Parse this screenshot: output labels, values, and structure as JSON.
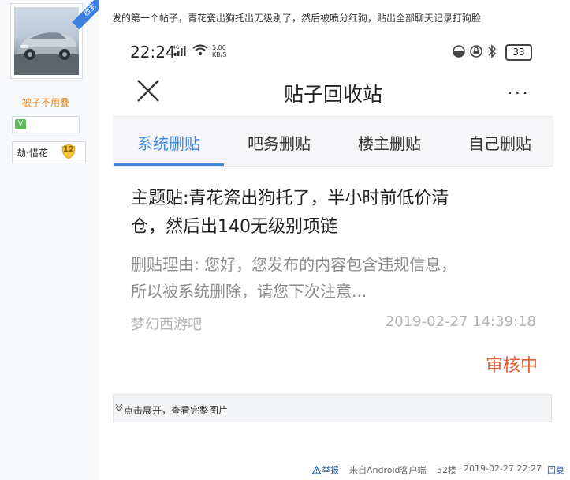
{
  "author": {
    "ribbon": "楼主",
    "username": "被子不用叠",
    "level_icon": "V",
    "fan_title": "劫·惜花",
    "fan_level": "12"
  },
  "post": {
    "text": "发的第一个帖子，青花瓷出狗托出无级别了，然后被喷分红狗，贴出全部聊天记录打狗脸"
  },
  "screenshot": {
    "status": {
      "time": "22:24",
      "speed_value": "5.00",
      "speed_unit": "KB/S",
      "battery": "33"
    },
    "nav_title": "贴子回收站",
    "more": "···",
    "tabs": [
      {
        "label": "系统删贴",
        "active": true
      },
      {
        "label": "吧务删贴",
        "active": false
      },
      {
        "label": "楼主删贴",
        "active": false
      },
      {
        "label": "自己删贴",
        "active": false
      }
    ],
    "card": {
      "title_line1": "主题贴:青花瓷出狗托了，半小时前低价清",
      "title_line2": "仓，然后出140无级别项链",
      "reason_line1": "删贴理由: 您好，您发布的内容包含违规信息，",
      "reason_line2": "所以被系统删除，请您下次注意...",
      "forum": "梦幻西游吧",
      "time": "2019-02-27 14:39:18",
      "status": "审核中"
    }
  },
  "expand": {
    "label": "点击展开，查看完整图片"
  },
  "footer": {
    "report": "举报",
    "client": "来自Android客户端",
    "floor": "52楼",
    "time": "2019-02-27 22:27",
    "reply": "回复"
  }
}
